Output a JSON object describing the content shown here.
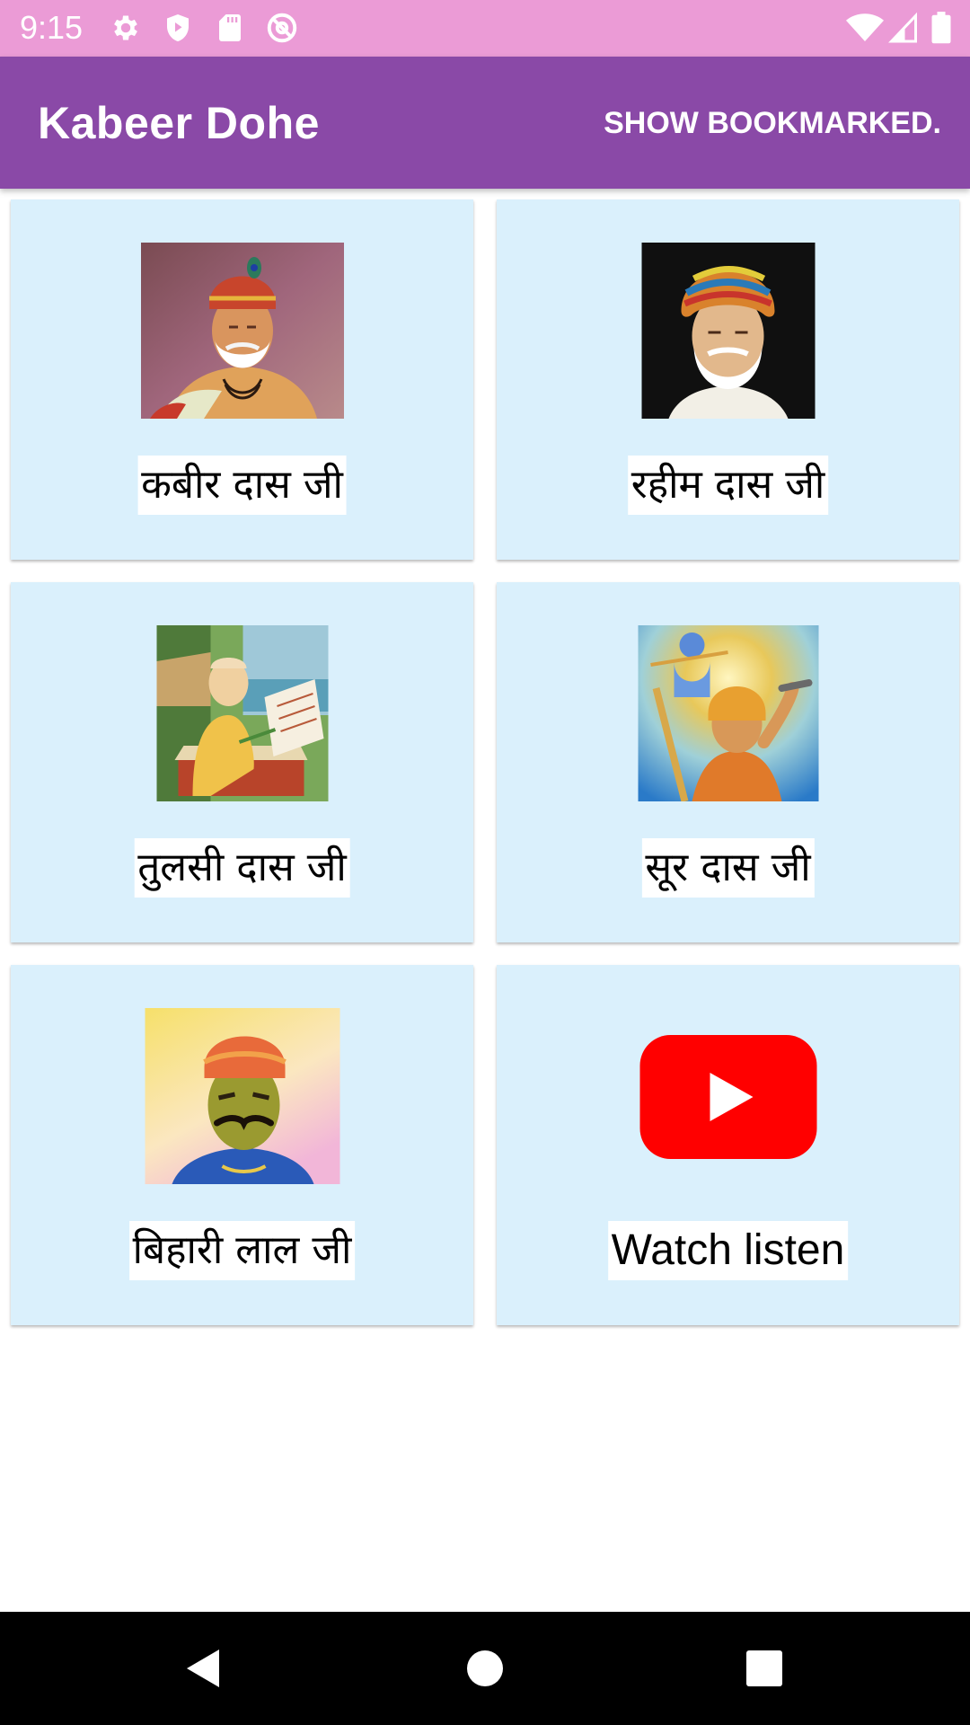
{
  "status_bar": {
    "time": "9:15",
    "background": "#eb9bd6",
    "left_icons": [
      "gear-icon",
      "shield-play-icon",
      "sd-card-icon",
      "at-sign-icon"
    ],
    "right_icons": [
      "wifi-icon",
      "signal-icon",
      "battery-icon"
    ]
  },
  "app_bar": {
    "title": "Kabeer Dohe",
    "action_label": "SHOW BOOKMARKED.",
    "background": "#8a49a7"
  },
  "cards": [
    {
      "label": "कबीर दास जी",
      "image": "kabir-portrait"
    },
    {
      "label": "रहीम दास जी",
      "image": "rahim-portrait"
    },
    {
      "label": "तुलसी दास जी",
      "image": "tulsidas-portrait"
    },
    {
      "label": "सूर दास जी",
      "image": "surdas-portrait"
    },
    {
      "label": "बिहारी लाल जी",
      "image": "bihari-portrait"
    },
    {
      "label": "Watch listen",
      "image": "youtube-icon"
    }
  ],
  "card_background": "#daf0fc",
  "nav_bar": {
    "buttons": [
      "back-icon",
      "home-icon",
      "recents-icon"
    ]
  }
}
